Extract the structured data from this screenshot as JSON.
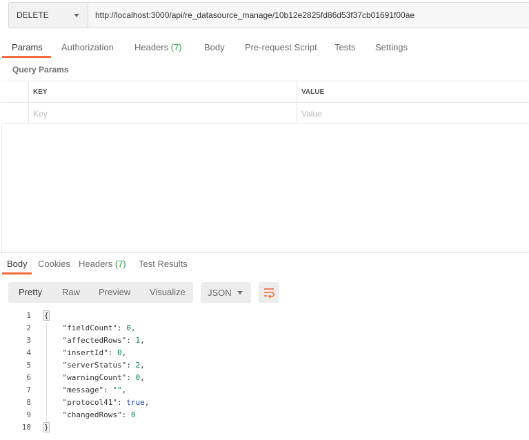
{
  "request": {
    "method": "DELETE",
    "url": "http://localhost:3000/api/re_datasource_manage/10b12e2825fd86d53f37cb01691f00ae"
  },
  "tabs": {
    "params": "Params",
    "authorization": "Authorization",
    "headers": "Headers",
    "headers_count": "(7)",
    "body": "Body",
    "prerequest": "Pre-request Script",
    "tests": "Tests",
    "settings": "Settings"
  },
  "query_params": {
    "title": "Query Params",
    "columns": [
      "KEY",
      "VALUE"
    ],
    "placeholder_key": "Key",
    "placeholder_value": "Value"
  },
  "response": {
    "tabs": {
      "body": "Body",
      "cookies": "Cookies",
      "headers": "Headers",
      "headers_count": "(7)",
      "test_results": "Test Results"
    },
    "view": {
      "pretty": "Pretty",
      "raw": "Raw",
      "preview": "Preview",
      "visualize": "Visualize",
      "format": "JSON"
    },
    "code_lines": [
      {
        "num": "1",
        "key": "",
        "value": "",
        "kind": "open"
      },
      {
        "num": "2",
        "key": "\"fieldCount\"",
        "value": "0",
        "kind": "number"
      },
      {
        "num": "3",
        "key": "\"affectedRows\"",
        "value": "1",
        "kind": "number"
      },
      {
        "num": "4",
        "key": "\"insertId\"",
        "value": "0",
        "kind": "number"
      },
      {
        "num": "5",
        "key": "\"serverStatus\"",
        "value": "2",
        "kind": "number"
      },
      {
        "num": "6",
        "key": "\"warningCount\"",
        "value": "0",
        "kind": "number"
      },
      {
        "num": "7",
        "key": "\"message\"",
        "value": "\"\"",
        "kind": "string"
      },
      {
        "num": "8",
        "key": "\"protocol41\"",
        "value": "true",
        "kind": "bool"
      },
      {
        "num": "9",
        "key": "\"changedRows\"",
        "value": "0",
        "kind": "number"
      },
      {
        "num": "10",
        "key": "",
        "value": "",
        "kind": "close"
      }
    ]
  },
  "colors": {
    "accent": "#f26b3a",
    "count_green": "#2f9e44"
  }
}
